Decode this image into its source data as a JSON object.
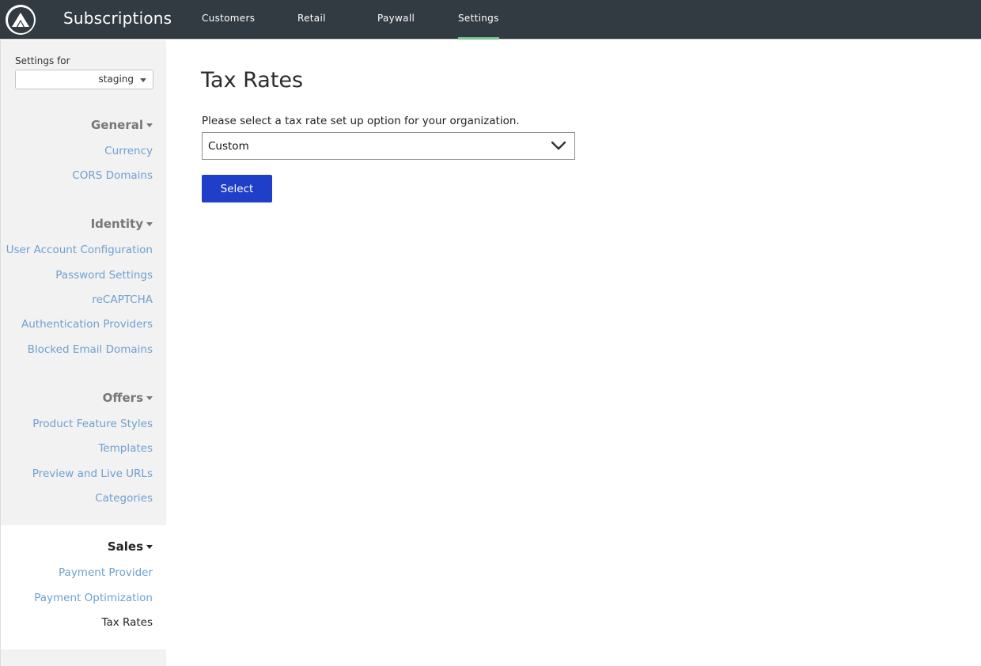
{
  "header": {
    "app_title": "Subscriptions",
    "logo_icon": "arc-logo-icon",
    "nav": [
      {
        "label": "Customers"
      },
      {
        "label": "Retail"
      },
      {
        "label": "Paywall"
      },
      {
        "label": "Settings",
        "active": true
      }
    ],
    "active_indicator_color": "#7fc79a"
  },
  "sidebar": {
    "settings_for_label": "Settings for",
    "environment_value": "staging",
    "sections": [
      {
        "title": "General",
        "items": [
          "Currency",
          "CORS Domains"
        ]
      },
      {
        "title": "Identity",
        "items": [
          "User Account Configuration",
          "Password Settings",
          "reCAPTCHA",
          "Authentication Providers",
          "Blocked Email Domains"
        ]
      },
      {
        "title": "Offers",
        "items": [
          "Product Feature Styles",
          "Templates",
          "Preview and Live URLs",
          "Categories"
        ]
      },
      {
        "title": "Sales",
        "items": [
          "Payment Provider",
          "Payment Optimization",
          "Tax Rates"
        ],
        "active": true
      }
    ],
    "current_item": "Tax Rates",
    "link_color": "#6fa0d2"
  },
  "main": {
    "title": "Tax Rates",
    "prompt": "Please select a tax rate set up option for your organization.",
    "tax_option_value": "Custom",
    "select_button_label": "Select",
    "button_color": "#1f3fc8"
  }
}
